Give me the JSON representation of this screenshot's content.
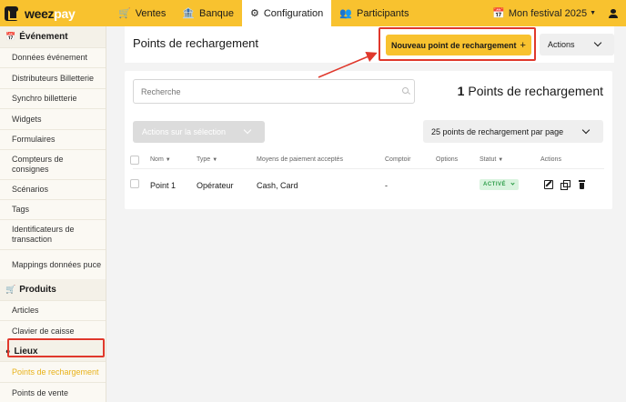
{
  "brand": {
    "name_part1": "weez",
    "name_part2": "pay"
  },
  "nav": {
    "items": [
      {
        "label": "Ventes",
        "icon": "cart-icon"
      },
      {
        "label": "Banque",
        "icon": "bank-icon"
      },
      {
        "label": "Configuration",
        "icon": "gear-icon"
      },
      {
        "label": "Participants",
        "icon": "users-icon"
      }
    ],
    "festival": "Mon festival 2025"
  },
  "sidebar": {
    "sections": [
      {
        "title": "Événement",
        "items": [
          "Données événement",
          "Distributeurs Billetterie",
          "Synchro billetterie",
          "Widgets",
          "Formulaires",
          "Compteurs de consignes",
          "Scénarios",
          "Tags",
          "Identificateurs de transaction",
          "Mappings données puce"
        ]
      },
      {
        "title": "Produits",
        "items": [
          "Articles",
          "Clavier de caisse"
        ]
      },
      {
        "title": "Lieux",
        "items": [
          "Points de rechargement",
          "Points de vente"
        ]
      }
    ]
  },
  "header": {
    "title": "Points de rechargement",
    "new_button": "Nouveau point de rechargement",
    "new_button_plus": "+",
    "actions_button": "Actions"
  },
  "toolbar": {
    "search_placeholder": "Recherche",
    "count": "1",
    "count_label": "Points de rechargement",
    "bulk_label": "Actions sur la sélection",
    "per_page": "25 points de rechargement par page"
  },
  "table": {
    "columns": [
      "Nom",
      "Type",
      "Moyens de paiement acceptés",
      "Comptoir",
      "Options",
      "Statut",
      "Actions"
    ],
    "rows": [
      {
        "name": "Point 1",
        "type": "Opérateur",
        "payments": "Cash, Card",
        "counter": "-",
        "options": "",
        "status": "ACTIVÉ"
      }
    ]
  },
  "colors": {
    "accent": "#f8c22f",
    "highlight": "#e0382c",
    "status_green": "#2f9e4a"
  }
}
